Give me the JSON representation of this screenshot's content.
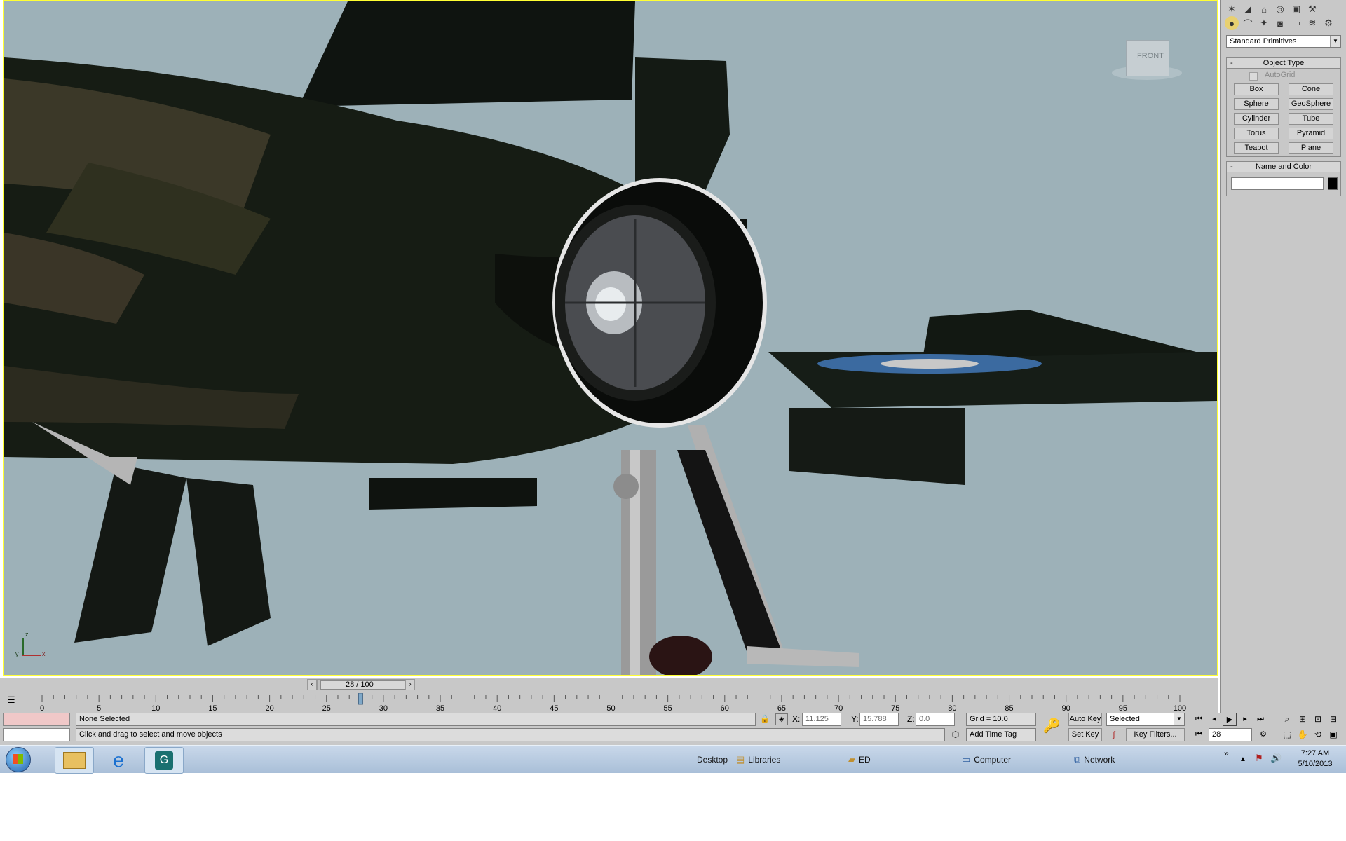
{
  "command_panel": {
    "category_dropdown": "Standard Primitives",
    "object_type": {
      "title": "Object Type",
      "autogrid": "AutoGrid",
      "buttons": [
        "Box",
        "Cone",
        "Sphere",
        "GeoSphere",
        "Cylinder",
        "Tube",
        "Torus",
        "Pyramid",
        "Teapot",
        "Plane"
      ]
    },
    "name_color": {
      "title": "Name and Color",
      "name_value": ""
    }
  },
  "viewport": {
    "viewcube_label": "FRONT",
    "axis_x": "x",
    "axis_y": "y",
    "axis_z": "z"
  },
  "timeline": {
    "frame_label": "28 / 100",
    "current_frame": 28,
    "total_frames": 100,
    "ticks": [
      "0",
      "5",
      "10",
      "15",
      "20",
      "25",
      "30",
      "35",
      "40",
      "45",
      "50",
      "55",
      "60",
      "65",
      "70",
      "75",
      "80",
      "85",
      "90",
      "95",
      "100"
    ]
  },
  "status": {
    "selection": "None Selected",
    "prompt": "Click and drag to select and move objects",
    "x_label": "X:",
    "x_value": "11.125",
    "y_label": "Y:",
    "y_value": "15.788",
    "z_label": "Z:",
    "z_value": "0.0",
    "grid": "Grid = 10.0",
    "add_time_tag": "Add Time Tag",
    "auto_key": "Auto Key",
    "set_key": "Set Key",
    "selected_dropdown": "Selected",
    "key_filters": "Key Filters...",
    "frame_field": "28"
  },
  "taskbar": {
    "desktop_label": "Desktop",
    "libraries": "Libraries",
    "ed": "ED",
    "computer": "Computer",
    "network": "Network",
    "time": "7:27 AM",
    "date": "5/10/2013"
  },
  "colors": {
    "viewport_bg": "#9db1b8",
    "viewport_border": "#ffff33",
    "panel_bg": "#c8c8c8"
  }
}
